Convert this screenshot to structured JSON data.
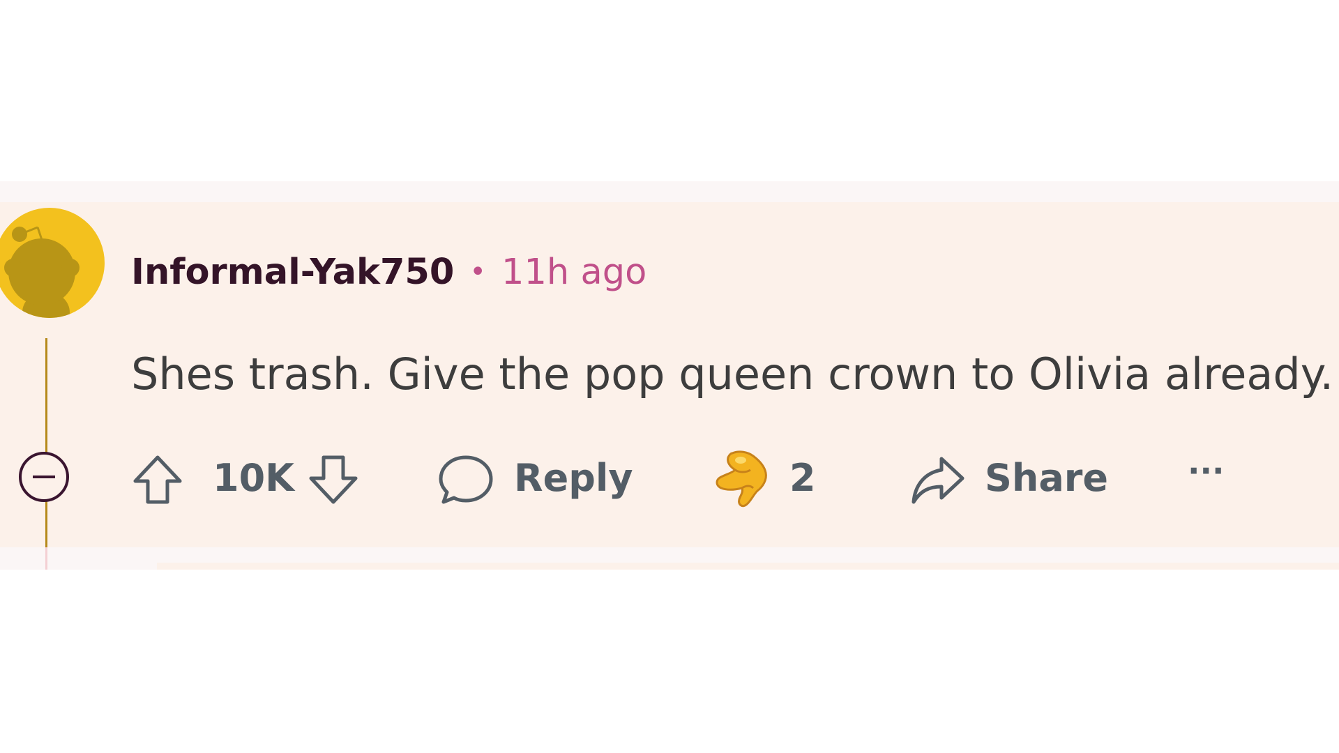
{
  "comment": {
    "username": "Informal-Yak750",
    "separator": "•",
    "timestamp": "11h ago",
    "text": "Shes trash. Give the pop queen crown to Olivia already.",
    "avatar_icon": "snoo-avatar-icon",
    "avatar_color": "#f3c11e"
  },
  "actions": {
    "vote_count": "10K",
    "reply_label": "Reply",
    "award_count": "2",
    "share_label": "Share",
    "more_label": "···"
  },
  "icons": {
    "upvote": "upvote-arrow-icon",
    "downvote": "downvote-arrow-icon",
    "reply": "speech-bubble-icon",
    "award": "pointing-hand-award-icon",
    "share": "share-arrow-icon",
    "collapse": "collapse-minus-icon"
  },
  "colors": {
    "username": "#341428",
    "timestamp": "#c0508a",
    "background": "#fcf1ea",
    "action_text": "#535d66"
  }
}
